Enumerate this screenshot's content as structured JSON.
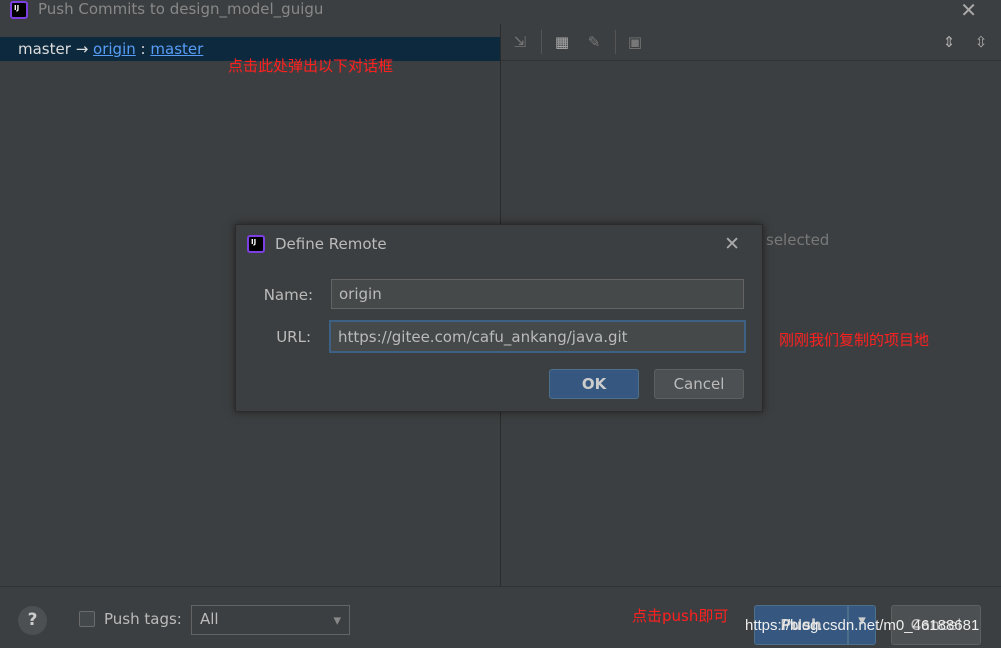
{
  "window": {
    "title": "Push Commits to design_model_guigu",
    "logo_text": "IJ"
  },
  "branch": {
    "local": "master",
    "arrow": "→",
    "remote": "origin",
    "sep": ":",
    "remote_branch": "master"
  },
  "annotations": {
    "click_here": "点击此处弹出以下对话框",
    "copied_address": "刚刚我们复制的项目地",
    "click_push": "点击push即可"
  },
  "details": {
    "empty_text": "selected"
  },
  "toolbar": {
    "icons": [
      "cherry-pick-icon",
      "group-by-icon",
      "edit-icon",
      "save-icon",
      "expand-all-icon",
      "collapse-all-icon"
    ]
  },
  "dialog": {
    "title": "Define Remote",
    "name_label": "Name:",
    "name_value": "origin",
    "url_label": "URL:",
    "url_value": "https://gitee.com/cafu_ankang/java.git",
    "ok": "OK",
    "cancel": "Cancel"
  },
  "bottom": {
    "help": "?",
    "push_tags_label": "Push tags:",
    "tags_value": "All",
    "push": "Push",
    "cancel": "Cancel",
    "dropdown": "▾"
  },
  "watermark": "https://blog.csdn.net/m0_46188681",
  "colors": {
    "accent": "#365880",
    "annotation": "#ff2020",
    "link": "#589df6",
    "selection": "#0d293e"
  }
}
